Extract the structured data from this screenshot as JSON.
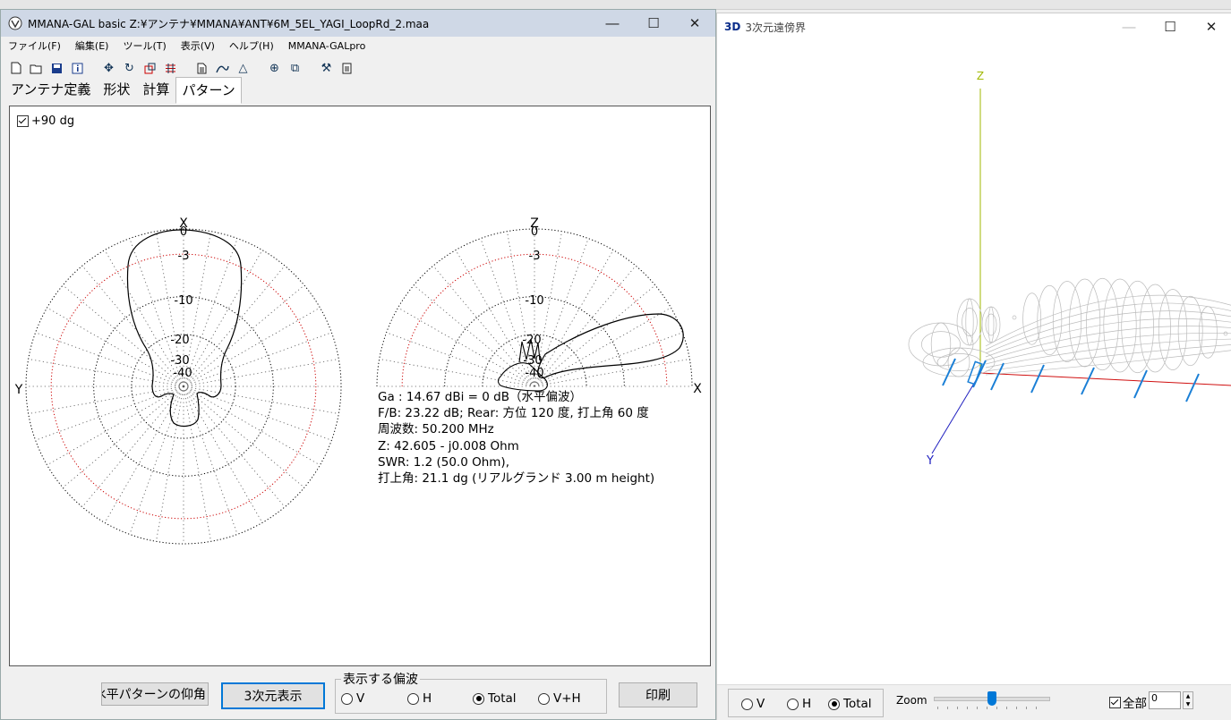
{
  "main": {
    "title": "MMANA-GAL basic Z:¥アンテナ¥MMANA¥ANT¥6M_5EL_YAGI_LoopRd_2.maa",
    "menus": [
      "ファイル(F)",
      "編集(E)",
      "ツール(T)",
      "表示(V)",
      "ヘルプ(H)",
      "MMANA-GALpro"
    ],
    "toolbar_icons": [
      "new-file-icon",
      "open-folder-icon",
      "save-icon",
      "info-icon",
      "move-icon",
      "rotate-icon",
      "stretch-icon",
      "wire-edit-icon",
      "text-file-icon",
      "graph-icon",
      "triangle-icon",
      "target-icon",
      "copy-icon",
      "tools-icon",
      "calculator-icon"
    ],
    "tabs": [
      "アンテナ定義",
      "形状",
      "計算",
      "パターン"
    ],
    "active_tab": "パターン",
    "plus90_label": "+90 dg",
    "plot": {
      "left_axis_top": "X",
      "left_axis_left": "Y",
      "right_axis_top": "Z",
      "right_axis_right": "X",
      "ring_labels": [
        "0",
        "-3",
        "-10",
        "-20",
        "-30",
        "-40"
      ]
    },
    "info_lines": [
      "Ga : 14.67 dBi = 0 dB（水平偏波）",
      "F/B: 23.22 dB; Rear: 方位 120 度,  打上角 60 度",
      "周波数: 50.200 MHz",
      "Z: 42.605 - j0.008 Ohm",
      "SWR: 1.2 (50.0 Ohm),",
      "打上角: 21.1 dg (リアルグランド  3.00 m height)"
    ],
    "btn_elev": "水平パターンの仰角",
    "btn_3d": "3次元表示",
    "polar_group_title": "表示する偏波",
    "polar_options": [
      "V",
      "H",
      "Total",
      "V+H"
    ],
    "polar_selected": "Total",
    "btn_print": "印刷"
  },
  "w3d": {
    "badge": "3D",
    "title": "3次元遠傍界",
    "axis_z": "Z",
    "axis_y": "Y",
    "polar_options": [
      "V",
      "H",
      "Total"
    ],
    "polar_selected": "Total",
    "zoom_label": "Zoom",
    "zoom_value": 0.5,
    "all_label": "全部",
    "spin_value": "0"
  }
}
